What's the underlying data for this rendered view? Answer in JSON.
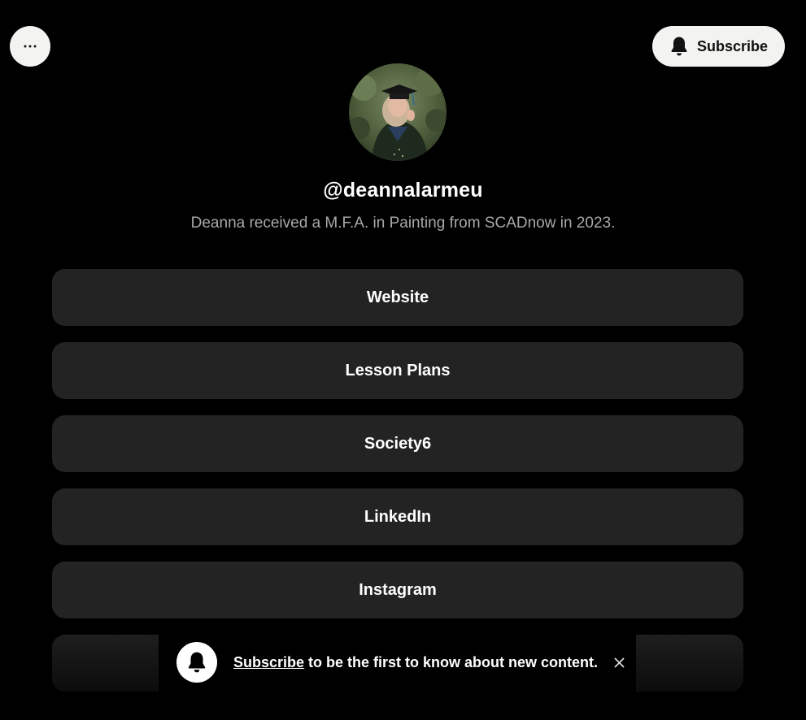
{
  "header": {
    "more_icon": "ellipsis-icon",
    "subscribe_icon": "bell-icon",
    "subscribe_label": "Subscribe"
  },
  "profile": {
    "title": "@deannalarmeu",
    "bio": "Deanna received a M.F.A. in Painting from SCADnow in 2023."
  },
  "links": [
    {
      "label": "Website"
    },
    {
      "label": "Lesson Plans"
    },
    {
      "label": "Society6"
    },
    {
      "label": "LinkedIn"
    },
    {
      "label": "Instagram"
    },
    {
      "label": ""
    }
  ],
  "toast": {
    "icon": "bell-icon",
    "link_text": "Subscribe",
    "text": " to be the first to know about new content.",
    "close_icon": "close-icon"
  },
  "colors": {
    "background": "#000000",
    "button": "#232323",
    "header_button": "#f3f3f1",
    "bio_text": "#a8a8a8"
  }
}
